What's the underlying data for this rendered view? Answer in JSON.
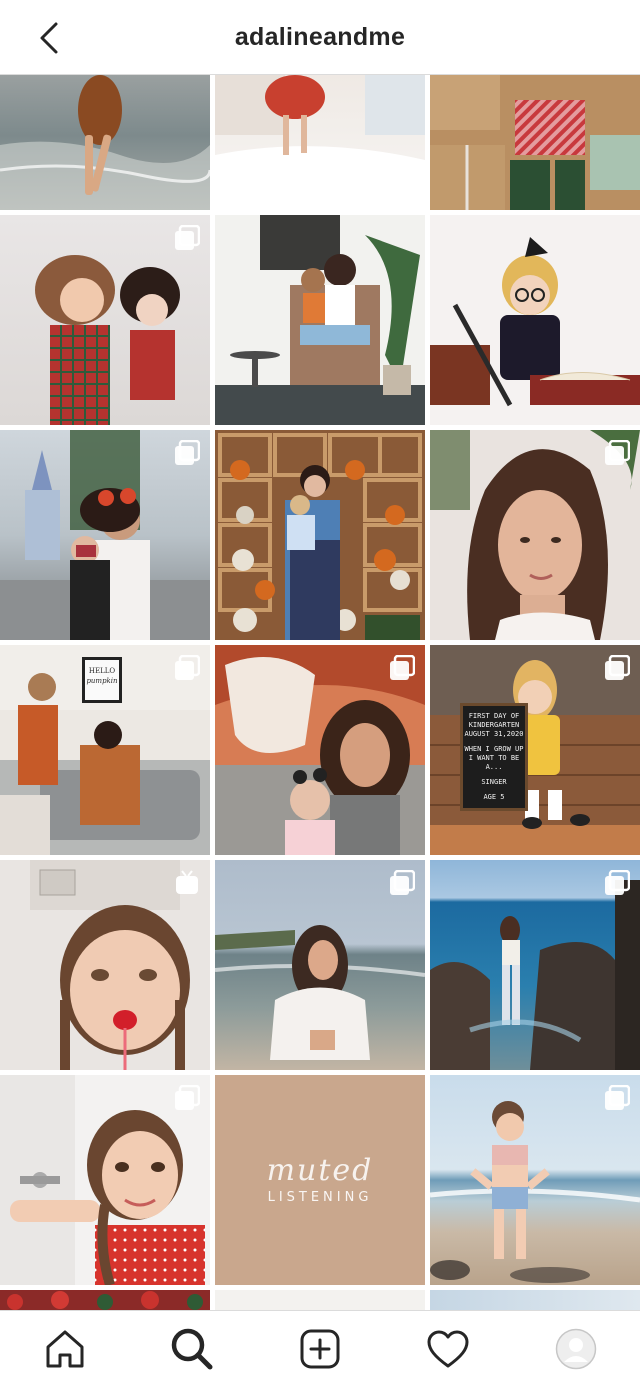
{
  "header": {
    "username": "adalineandme",
    "back_icon": "chevron-left-icon"
  },
  "grid": {
    "posts": [
      {
        "id": "post-1",
        "kind": "photo",
        "multi": false,
        "subject": "child-in-dress-on-beach"
      },
      {
        "id": "post-2",
        "kind": "photo",
        "multi": false,
        "subject": "girl-jumping-on-bed"
      },
      {
        "id": "post-3",
        "kind": "photo",
        "multi": false,
        "subject": "wrapped-christmas-gifts"
      },
      {
        "id": "post-4",
        "kind": "carousel",
        "multi": true,
        "subject": "girl-with-doll-in-plaid"
      },
      {
        "id": "post-5",
        "kind": "photo",
        "multi": false,
        "subject": "mother-daughter-on-porch-chair"
      },
      {
        "id": "post-6",
        "kind": "photo",
        "multi": false,
        "subject": "girl-with-books-and-wand"
      },
      {
        "id": "post-7",
        "kind": "carousel",
        "multi": true,
        "subject": "mother-daughter-at-castle"
      },
      {
        "id": "post-8",
        "kind": "photo",
        "multi": false,
        "subject": "pumpkin-crates-photo"
      },
      {
        "id": "post-9",
        "kind": "carousel",
        "multi": true,
        "subject": "woman-selfie"
      },
      {
        "id": "post-10",
        "kind": "carousel",
        "multi": true,
        "subject": "mother-daughter-living-room",
        "sign_text": [
          "HELLO",
          "pumpkin"
        ]
      },
      {
        "id": "post-11",
        "kind": "carousel",
        "multi": true,
        "subject": "teacup-ride"
      },
      {
        "id": "post-12",
        "kind": "carousel",
        "multi": true,
        "subject": "first-day-of-kindergarten",
        "board_lines": [
          "FIRST DAY OF",
          "KINDERGARTEN",
          "AUGUST 31,2020",
          "",
          "WHEN I GROW UP",
          "I WANT TO BE A...",
          "",
          "SINGER",
          "",
          "AGE 5"
        ]
      },
      {
        "id": "post-13",
        "kind": "video",
        "multi": false,
        "subject": "girl-with-popsicle"
      },
      {
        "id": "post-14",
        "kind": "carousel",
        "multi": true,
        "subject": "woman-at-beach"
      },
      {
        "id": "post-15",
        "kind": "carousel",
        "multi": true,
        "subject": "woman-on-rocks-by-sea"
      },
      {
        "id": "post-16",
        "kind": "carousel",
        "multi": true,
        "subject": "girl-with-braid"
      },
      {
        "id": "post-17",
        "kind": "graphic",
        "multi": false,
        "subject": "muted-listening",
        "line1": "muted",
        "line2": "LISTENING"
      },
      {
        "id": "post-18",
        "kind": "carousel",
        "multi": true,
        "subject": "toddler-on-beach"
      }
    ]
  },
  "bottom_nav": {
    "items": [
      {
        "name": "home",
        "icon": "home-icon"
      },
      {
        "name": "search",
        "icon": "search-icon",
        "active": true
      },
      {
        "name": "new-post",
        "icon": "plus-square-icon"
      },
      {
        "name": "activity",
        "icon": "heart-icon"
      },
      {
        "name": "profile",
        "icon": "avatar-icon"
      }
    ]
  },
  "colors": {
    "text": "#262626",
    "border": "#dbdbdb",
    "muted_tile": "#c9a78d"
  }
}
